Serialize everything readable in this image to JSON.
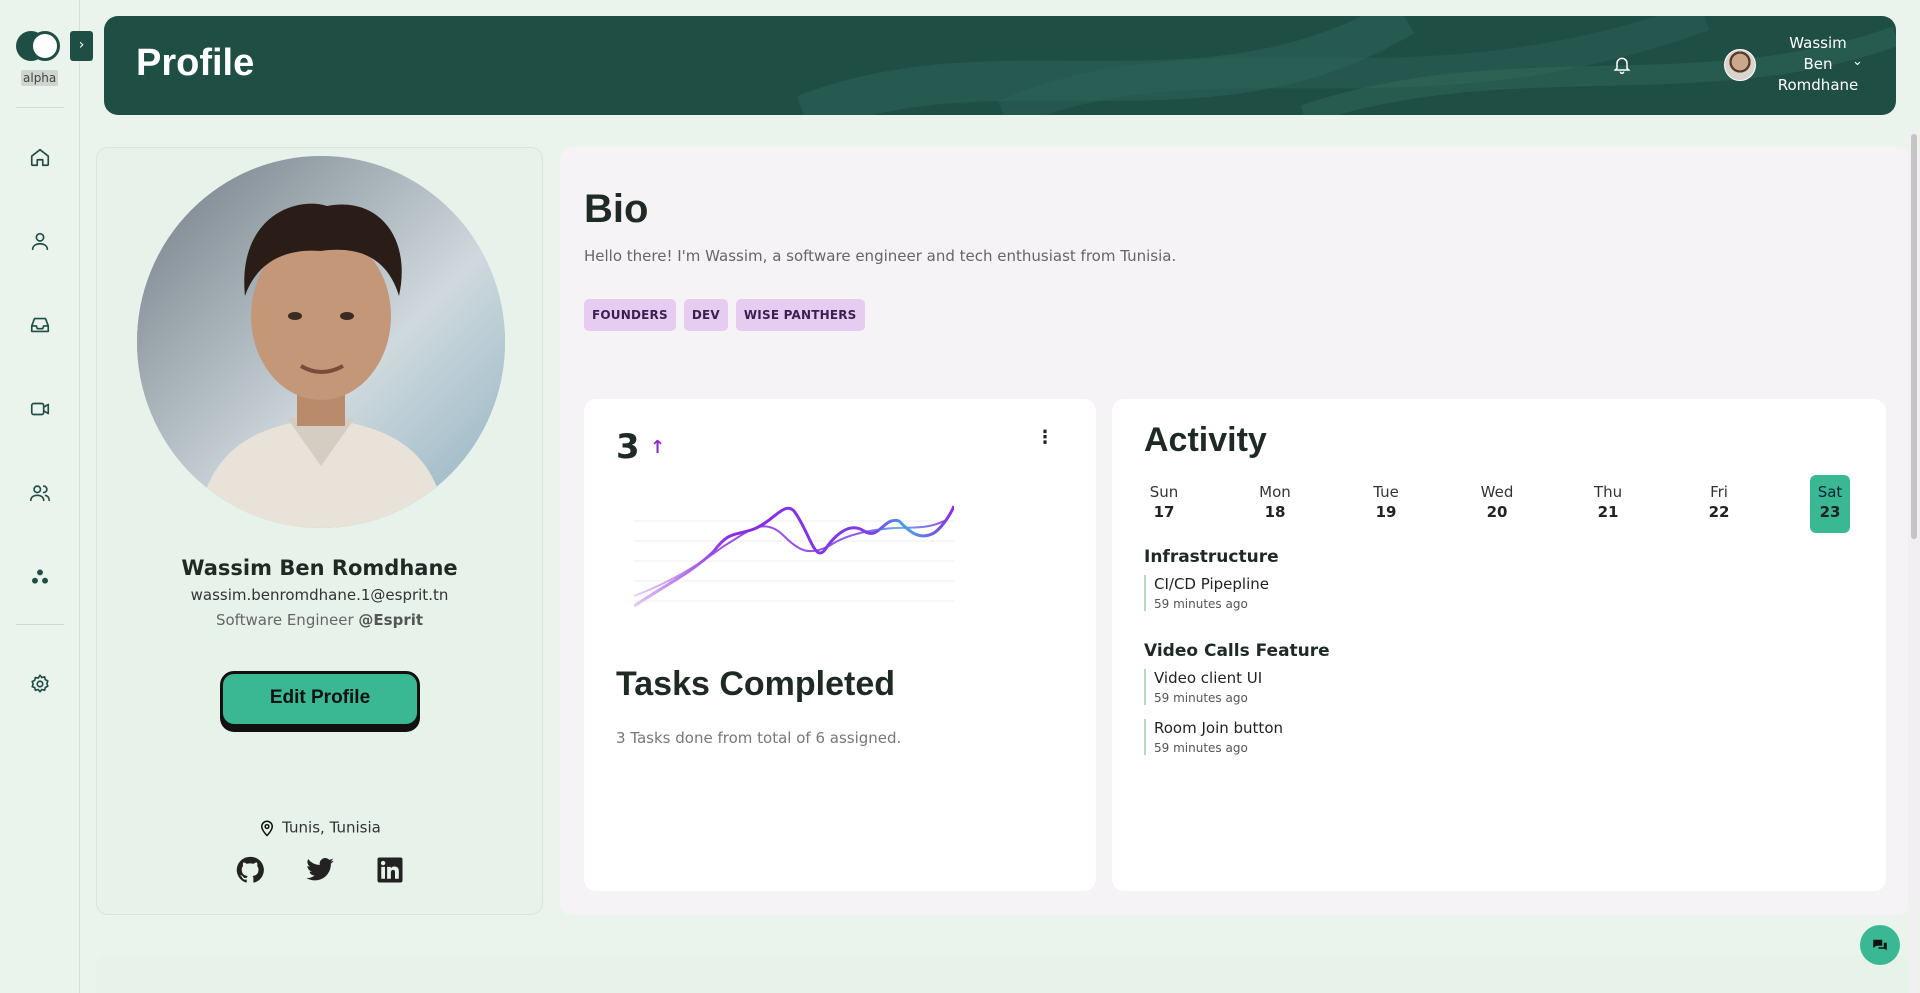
{
  "app": {
    "badge": "alpha",
    "expand_glyph": "›"
  },
  "header": {
    "title": "Profile",
    "user": {
      "first": "Wassim",
      "middle": "Ben",
      "last": "Romdhane"
    }
  },
  "sidebar": {
    "items": [
      {
        "icon": "home-icon"
      },
      {
        "icon": "user-icon"
      },
      {
        "icon": "inbox-icon"
      },
      {
        "icon": "video-icon"
      },
      {
        "icon": "users-icon"
      },
      {
        "icon": "workspaces-icon"
      },
      {
        "icon": "gear-icon"
      }
    ]
  },
  "profile": {
    "name": "Wassim Ben Romdhane",
    "email": "wassim.benromdhane.1@esprit.tn",
    "role": "Software Engineer",
    "company": "@Esprit",
    "edit_label": "Edit Profile",
    "location": "Tunis, Tunisia",
    "socials": [
      "github-icon",
      "twitter-icon",
      "linkedin-icon"
    ]
  },
  "bio": {
    "title": "Bio",
    "text": "Hello there! I'm Wassim, a software engineer and tech enthusiast from Tunisia.",
    "tags": [
      "FOUNDERS",
      "DEV",
      "WISE PANTHERS"
    ]
  },
  "tasks": {
    "count": "3",
    "trend_glyph": "↑",
    "menu_glyph": "⋮",
    "title": "Tasks Completed",
    "subtitle": "3 Tasks done from total of 6 assigned."
  },
  "activity": {
    "title": "Activity",
    "days": [
      {
        "name": "Sun",
        "num": "17"
      },
      {
        "name": "Mon",
        "num": "18"
      },
      {
        "name": "Tue",
        "num": "19"
      },
      {
        "name": "Wed",
        "num": "20"
      },
      {
        "name": "Thu",
        "num": "21"
      },
      {
        "name": "Fri",
        "num": "22"
      },
      {
        "name": "Sat",
        "num": "23"
      }
    ],
    "active_day": "Sat",
    "groups": [
      {
        "title": "Infrastructure",
        "items": [
          {
            "name": "CI/CD Pipepline",
            "time": "59 minutes ago"
          }
        ]
      },
      {
        "title": "Video Calls Feature",
        "items": [
          {
            "name": "Video client UI",
            "time": "59 minutes ago"
          },
          {
            "name": "Room Join button",
            "time": "59 minutes ago"
          }
        ]
      }
    ]
  },
  "colors": {
    "brand": "#1f4e45",
    "accent": "#3ab894",
    "tag_bg": "#e6ccf1",
    "trend": "#8b2bc9"
  }
}
